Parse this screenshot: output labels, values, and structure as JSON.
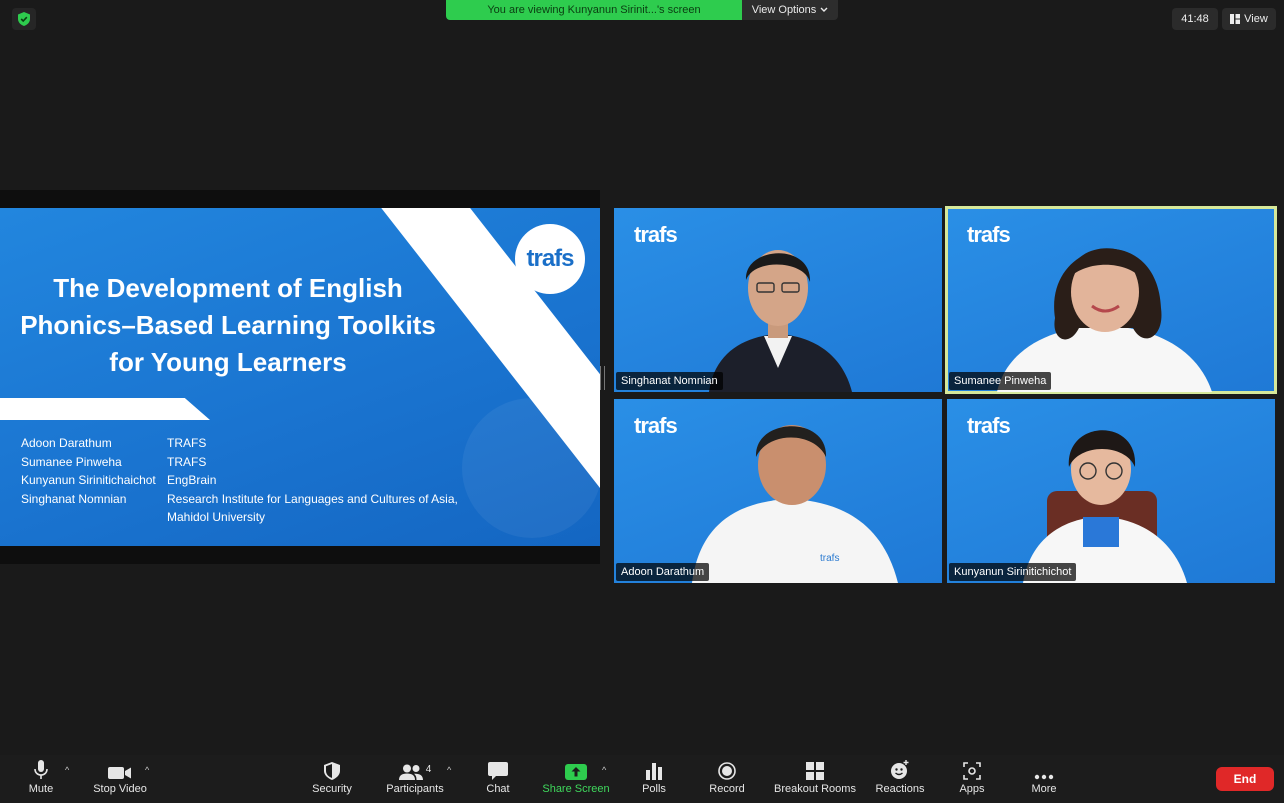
{
  "top_bar": {
    "share_message": "You are viewing Kunyanun Sirinit...'s screen",
    "view_options_label": "View Options",
    "timer": "41:48",
    "view_label": "View"
  },
  "shared_slide": {
    "title_lines": [
      "The Development of English",
      "Phonics–Based Learning Toolkits",
      "for Young Learners"
    ],
    "logo_text": "trafs",
    "authors": [
      {
        "name": "Adoon Darathum",
        "affiliation": "TRAFS"
      },
      {
        "name": "Sumanee Pinweha",
        "affiliation": "TRAFS"
      },
      {
        "name": "Kunyanun Sirinitichaichot",
        "affiliation": "EngBrain"
      },
      {
        "name": "Singhanat Nomnian",
        "affiliation": "Research Institute for Languages and Cultures of Asia,"
      },
      {
        "name": "",
        "affiliation": "Mahidol University"
      }
    ]
  },
  "participants": [
    {
      "name": "Singhanat Nomnian",
      "brand": "trafs"
    },
    {
      "name": "Sumanee Pinweha",
      "brand": "trafs",
      "active_speaker": true
    },
    {
      "name": "Adoon Darathum",
      "brand": "trafs"
    },
    {
      "name": "Kunyanun Sirinitichichot",
      "brand": "trafs"
    }
  ],
  "toolbar": {
    "mute": "Mute",
    "stop_video": "Stop Video",
    "security": "Security",
    "participants": "Participants",
    "participants_count": "4",
    "chat": "Chat",
    "share_screen": "Share Screen",
    "polls": "Polls",
    "record": "Record",
    "breakout_rooms": "Breakout Rooms",
    "reactions": "Reactions",
    "apps": "Apps",
    "more": "More",
    "end": "End"
  },
  "colors": {
    "share_green": "#2ecc4e",
    "end_red": "#e02828",
    "slide_blue": "#1a74d0",
    "active_speaker_border": "#d6e89a"
  }
}
